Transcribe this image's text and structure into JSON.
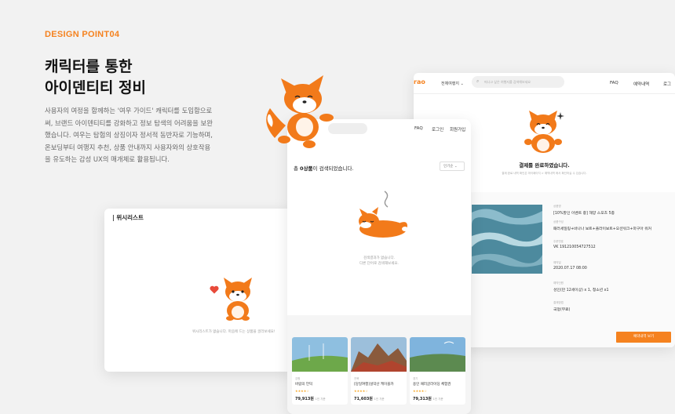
{
  "section": {
    "tag": "DESIGN POINT04",
    "headline_line1": "캐릭터를 통한",
    "headline_line2": "아이덴티티 정비",
    "desc_lines": [
      "사용자의 여정을 함께하는 '여우 가이드' 캐릭터를 도입함으로",
      "써, 브랜드 아이덴티티를 강화하고 정보 탐색의 어려움을 보완",
      "했습니다. 여우는 탐험의 상징이자 정서적 동반자로 기능하며,",
      "온보딩부터 여행지 추천, 상품 안내까지 사용자와의 상호작용",
      "을 유도하는 감성 UX의 매개체로 활용됩니다."
    ]
  },
  "wishlist": {
    "title": "위시리스트",
    "empty_text": "위시리스트가 없습니다. 마음에 드는 상품을 골라보세요!"
  },
  "search_screen": {
    "nav": {
      "faq": "FAQ",
      "login": "로그인",
      "signup": "회원가입"
    },
    "count_prefix": "총 ",
    "count_bold": "0상품",
    "count_suffix": "이 검색되었습니다.",
    "sort_label": "인기순",
    "empty_line1": "검색결과가 없습니다.",
    "empty_line2": "다른 단어로 검색해보세요.",
    "products": [
      {
        "region": "강원",
        "name": "바람의 언덕",
        "stars": "★★★★☆",
        "price": "79,913원",
        "price_note": "1인 기준"
      },
      {
        "region": "전북",
        "name": "[당일여행]설악산 케이블카",
        "stars": "★★★★☆",
        "price": "71,603원",
        "price_note": "1인 기준"
      },
      {
        "region": "경기",
        "name": "용인 패러글라이딩 체험권",
        "stars": "★★★★☆",
        "price": "79,313원",
        "price_note": "1인 기준"
      }
    ]
  },
  "payment_screen": {
    "logo": "rao",
    "menu": "전체여행지",
    "search_placeholder": "떠나고 싶은 여행지를 검색해보세요",
    "nav": {
      "faq": "FAQ",
      "reservations": "예약내역",
      "more": "로그"
    },
    "done_title": "결제를 완료하였습니다.",
    "done_sub": "결제 완료 내역 확인은 마이페이지 > 예약내역 에서 확인하실 수 있습니다.",
    "fields": [
      {
        "label": "상품명",
        "value": "[10%할인 이벤트 중] 해양 스포츠 5종"
      },
      {
        "label": "상품구성",
        "value": "패러세일링+바나나 보트+플라이보트+오션워크+마구아 워커"
      },
      {
        "label": "주문번호",
        "value": "VK 19121005472751​2"
      },
      {
        "label": "예약일",
        "value": "2020.07.17 08:00"
      },
      {
        "label": "예약인원",
        "value": "성인(만 12세이상) x 1, 청소년 x1"
      },
      {
        "label": "결제방법",
        "value": "국정(무료)"
      }
    ],
    "cta_label": "예약내역 보기"
  },
  "colors": {
    "accent": "#f5821f",
    "fox_orange": "#f27a1a"
  },
  "icons": [
    "fox-character-icon",
    "heart-icon",
    "search-icon",
    "sparkle-icon",
    "chevron-down-icon"
  ]
}
